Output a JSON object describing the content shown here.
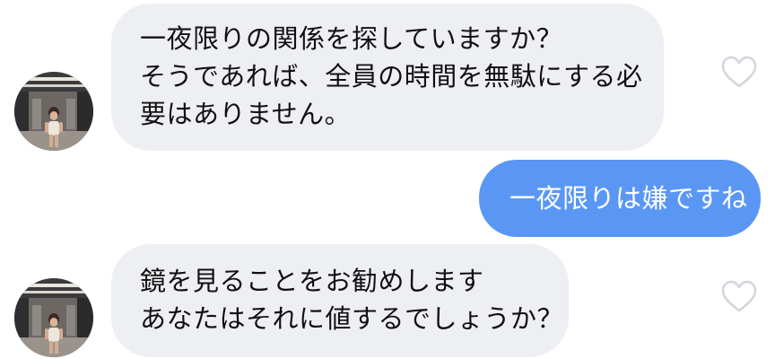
{
  "messages": [
    {
      "direction": "incoming",
      "lines": [
        "一夜限りの関係を探していますか？",
        "そうであれば、全員の時間を無駄にする必",
        "要はありません。"
      ],
      "liked": false
    },
    {
      "direction": "outgoing",
      "lines": [
        "一夜限りは嫌ですね"
      ]
    },
    {
      "direction": "incoming",
      "lines": [
        "鏡を見ることをお勧めします",
        "あなたはそれに値するでしょうか？"
      ],
      "liked": false
    }
  ],
  "colors": {
    "incoming_bubble": "#eeeff3",
    "outgoing_bubble": "#5a97f5",
    "heart_outline": "#d3d5db"
  },
  "icons": {
    "avatar": "profile-photo-gym",
    "like": "heart-outline-icon"
  }
}
